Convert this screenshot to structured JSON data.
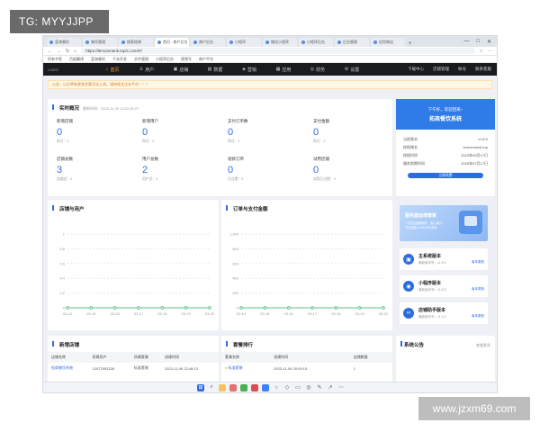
{
  "watermarks": {
    "top_left": "TG: MYYJJPP",
    "bottom_right": "www.jzxm69.com"
  },
  "browser": {
    "tabs": [
      "蓝海餐饮",
      "餐饮管理",
      "搜索结果",
      "首页 - 商户后台",
      "商户后台",
      "小程序",
      "",
      "微信小程序",
      "小程序后台",
      "后台管理",
      "应用商店"
    ],
    "url": "https://lemonmenk.top/c.com/#/",
    "bookmarks": [
      "所有书签",
      "百度翻译",
      "蓝海餐饮",
      "千米开发",
      "文件管理",
      "小程序后台",
      "视频号",
      "商户平台"
    ],
    "window_controls": [
      "—",
      "□",
      "✕"
    ]
  },
  "header": {
    "logo": "LOGO",
    "nav": [
      "首页",
      "用户",
      "店铺",
      "数据",
      "营销",
      "应用",
      "财务",
      "设置"
    ],
    "right": [
      "下载中心",
      "店铺管理",
      "帐号",
      "联系客服"
    ]
  },
  "notice": "公告：以后将有更多优惠活动上线，请持续关注本平台！！！",
  "overview": {
    "title": "实时概况",
    "updated": "更新时间：2023-11-20 11:52:26:27",
    "stats": [
      {
        "label": "新增店铺",
        "value": "0",
        "sub": "昨日：0"
      },
      {
        "label": "新增用户",
        "value": "0",
        "sub": "昨日：0"
      },
      {
        "label": "支付订单数",
        "value": "0",
        "sub": "昨日：0"
      },
      {
        "label": "支付金额",
        "value": "0",
        "sub": "昨日：0"
      },
      {
        "label": "店铺总数",
        "value": "3",
        "sub": "店铺总：0"
      },
      {
        "label": "用户总数",
        "value": "2",
        "sub": "用户总：0"
      },
      {
        "label": "退款订单",
        "value": "0",
        "sub": "已过期：0"
      },
      {
        "label": "试用店铺",
        "value": "0",
        "sub": "试用已过期：0"
      }
    ]
  },
  "system_info": {
    "banner_line1": "下午好，欢迎回来~",
    "banner_line2": "拓商餐饮系统",
    "rows": [
      {
        "k": "当前版本",
        "v": "v1.8.0"
      },
      {
        "k": "授权域名",
        "v": "lemonmenk.top"
      },
      {
        "k": "授权时间",
        "v": "2023年09月17日"
      },
      {
        "k": "服务到期时间",
        "v": "2025年07月17日"
      }
    ],
    "button": "立即续费"
  },
  "chart_stores_users": {
    "title": "店铺与用户",
    "chart_data": {
      "type": "line",
      "categories": [
        "03-14",
        "03-15",
        "03-16",
        "03-17",
        "03-18",
        "03-19",
        "03-20"
      ],
      "series": [
        {
          "values": [
            0,
            0,
            0,
            0,
            0,
            0,
            0
          ]
        },
        {
          "values": [
            0,
            0,
            0,
            0,
            0,
            0,
            0
          ]
        }
      ],
      "yticks": [
        "0",
        "0.2",
        "0.4",
        "0.6",
        "0.8",
        "1"
      ],
      "ylim": [
        0,
        1
      ],
      "series_color": "#5fbf8a"
    }
  },
  "chart_orders_payments": {
    "title": "订单与支付金额",
    "chart_data": {
      "type": "line",
      "categories": [
        "03-14",
        "03-15",
        "03-16",
        "03-17",
        "03-18",
        "03-19",
        "03-20"
      ],
      "series": [
        {
          "values": [
            0,
            0,
            0,
            0,
            0,
            0,
            0
          ]
        },
        {
          "values": [
            0,
            0,
            0,
            0,
            0,
            0,
            0
          ]
        }
      ],
      "yticks": [
        "0",
        "200",
        "400",
        "600",
        "800",
        "1,000"
      ],
      "ylim": [
        0,
        1000
      ],
      "series_color": "#5fbf8a"
    }
  },
  "promo": {
    "title": "服务器运维管家",
    "sub1": "一站式运维服务，省心省力",
    "sub2": "专业团队7x24小时支持"
  },
  "versions": [
    {
      "name": "主系统版本",
      "num": "最新版本号：v1.8.0",
      "link": "版本更新",
      "icon": "server-icon"
    },
    {
      "name": "小程序版本",
      "num": "最新版本号：v1.8.2",
      "link": "版本更新",
      "icon": "miniapp-icon"
    },
    {
      "name": "店铺助手版本",
      "num": "最新版本号：v1.2.0",
      "link": "版本更新",
      "icon": "link-icon"
    }
  ],
  "new_stores": {
    "title": "新增店铺",
    "columns": [
      "店铺名称",
      "所属用户",
      "所属套餐",
      "创建时间"
    ],
    "rows": [
      [
        "拓商餐饮系统",
        "13472991326",
        "标准套餐",
        "2023-11-06 22:48:13"
      ]
    ]
  },
  "package_rank": {
    "title": "套餐排行",
    "columns": [
      "套餐名称",
      "创建时间",
      "店铺数量"
    ],
    "rows": [
      [
        "标准套餐",
        "2023-11-06 16:09:15",
        "1"
      ]
    ]
  },
  "announcements": {
    "title": "系统公告",
    "more": "查看更多"
  }
}
